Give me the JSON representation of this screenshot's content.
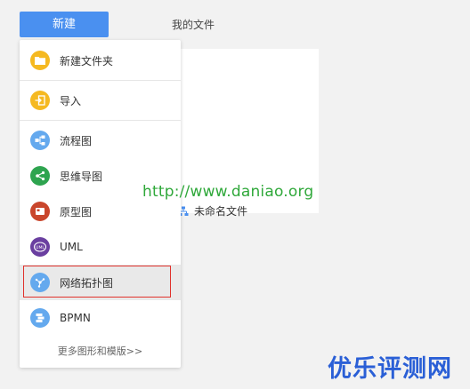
{
  "toolbar": {
    "new_label": "新建",
    "my_files_label": "我的文件"
  },
  "file_list": {
    "items": [
      {
        "name": "未命名文件",
        "icon": "flow-file-icon"
      }
    ]
  },
  "menu": {
    "items": [
      {
        "label": "新建文件夹",
        "icon": "folder-icon",
        "color": "#f5b921"
      },
      {
        "label": "导入",
        "icon": "import-icon",
        "color": "#f5b921"
      },
      {
        "label": "流程图",
        "icon": "flowchart-icon",
        "color": "#64a9ee"
      },
      {
        "label": "思维导图",
        "icon": "mindmap-icon",
        "color": "#2ea44f"
      },
      {
        "label": "原型图",
        "icon": "prototype-icon",
        "color": "#c9462c"
      },
      {
        "label": "UML",
        "icon": "uml-icon",
        "color": "#6a3fa0"
      },
      {
        "label": "网络拓扑图",
        "icon": "network-topology-icon",
        "color": "#64a9ee",
        "highlighted": true
      },
      {
        "label": "BPMN",
        "icon": "bpmn-icon",
        "color": "#64a9ee"
      }
    ],
    "more_label": "更多图形和模版>>"
  },
  "watermarks": {
    "url": "http://www.daniao.org",
    "site": "优乐评测网"
  },
  "colors": {
    "primary": "#4a90f0",
    "highlight_border": "#e0322c",
    "watermark_green": "#2fa83a",
    "watermark_blue": "#2a5fd6"
  }
}
